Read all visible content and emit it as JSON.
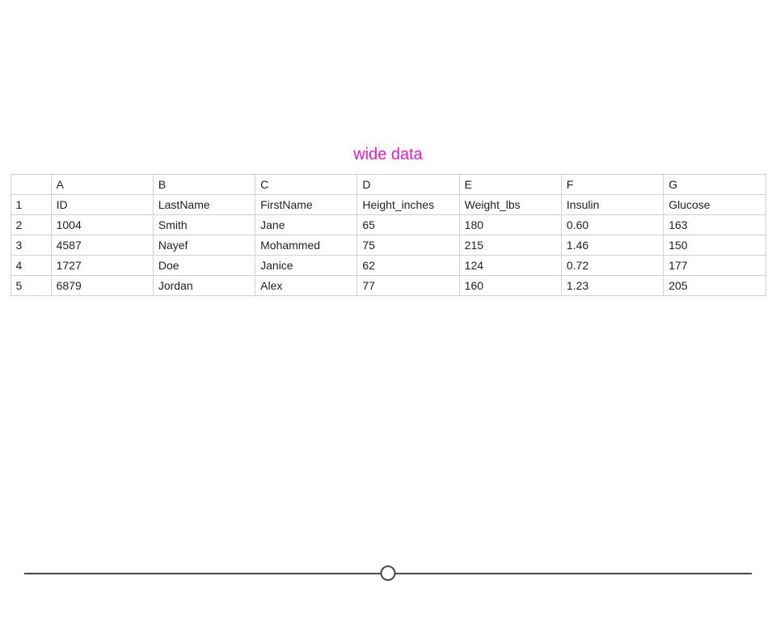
{
  "title": "wide data",
  "column_letters": [
    "A",
    "B",
    "C",
    "D",
    "E",
    "F",
    "G"
  ],
  "header_row_num": "1",
  "headers": [
    "ID",
    "LastName",
    "FirstName",
    "Height_inches",
    "Weight_lbs",
    "Insulin",
    "Glucose"
  ],
  "rows": [
    {
      "num": "2",
      "id": "1004",
      "last": "Smith",
      "first": "Jane",
      "height": "65",
      "weight": "180",
      "insulin": "0.60",
      "glucose": "163"
    },
    {
      "num": "3",
      "id": "4587",
      "last": "Nayef",
      "first": "Mohammed",
      "height": "75",
      "weight": "215",
      "insulin": "1.46",
      "glucose": "150"
    },
    {
      "num": "4",
      "id": "1727",
      "last": "Doe",
      "first": "Janice",
      "height": "62",
      "weight": "124",
      "insulin": "0.72",
      "glucose": "177"
    },
    {
      "num": "5",
      "id": "6879",
      "last": "Jordan",
      "first": "Alex",
      "height": "77",
      "weight": "160",
      "insulin": "1.23",
      "glucose": "205"
    }
  ]
}
